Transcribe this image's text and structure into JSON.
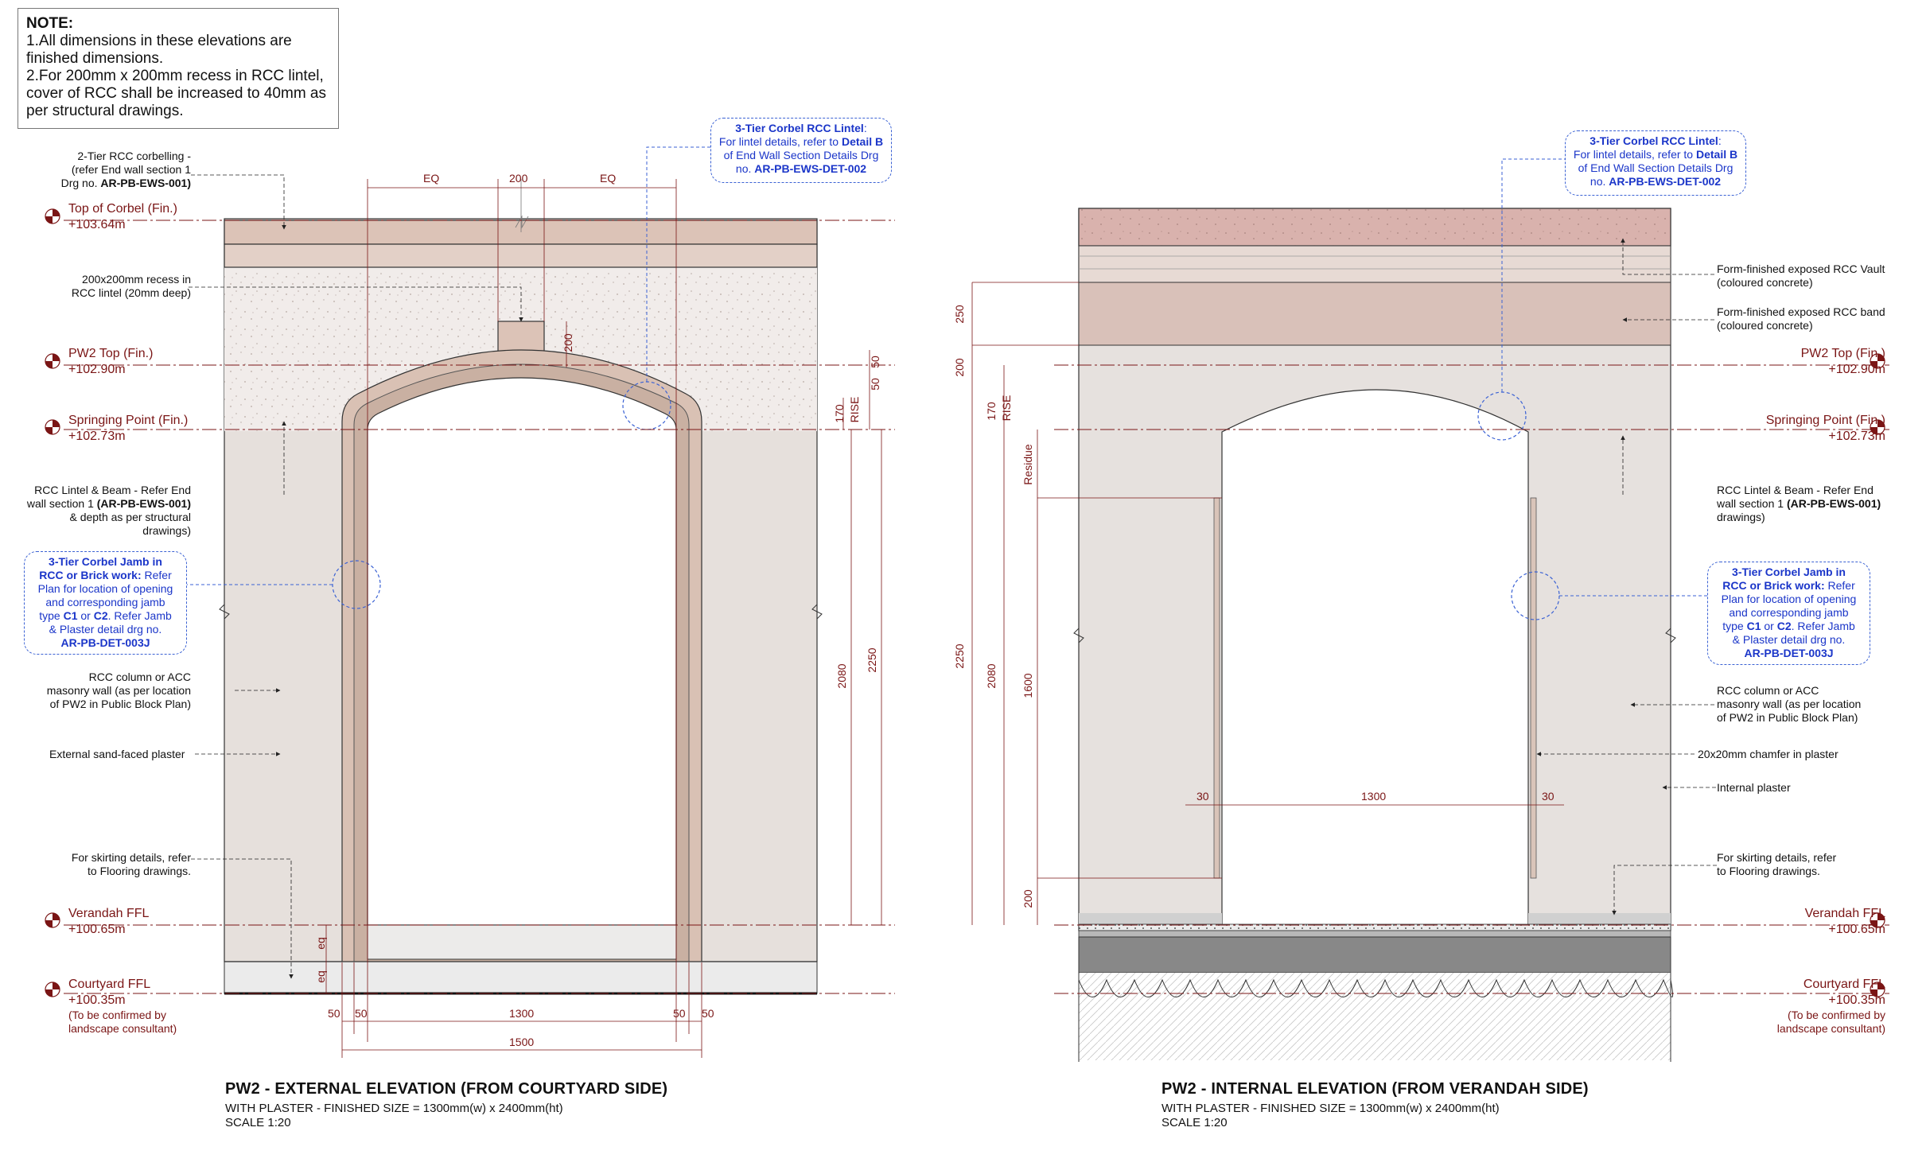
{
  "note": {
    "heading": "NOTE:",
    "line1": "1.All dimensions in these elevations are finished dimensions.",
    "line2": "2.For 200mm x 200mm recess in RCC lintel, cover of RCC shall be increased to 40mm as per structural drawings."
  },
  "left": {
    "labels": {
      "corbelling_a": "2-Tier RCC corbelling -",
      "corbelling_b": "(refer End wall section 1",
      "corbelling_c": "Drg no.",
      "corbelling_ref": "AR-PB-EWS-001)",
      "recess_a": "200x200mm recess in",
      "recess_b": "RCC lintel (20mm deep)",
      "lintel_a": "RCC Lintel & Beam - Refer End",
      "lintel_b": "wall section 1",
      "lintel_ref": "(AR-PB-EWS-001)",
      "lintel_c": "& depth as per structural",
      "lintel_d": "drawings)",
      "column_a": "RCC column or ACC",
      "column_b": "masonry wall (as per location",
      "column_c": "of PW2 in Public Block Plan)",
      "plaster": "External sand-faced plaster",
      "skirting_a": "For skirting details, refer",
      "skirting_b": "to Flooring drawings."
    },
    "jamb_callout": {
      "title_a": "3-Tier Corbel Jamb in",
      "title_b": "RCC or Brick work:",
      "text_a": "Refer",
      "text_b": "Plan for location of opening",
      "text_c": "and corresponding jamb",
      "text_d": "type",
      "c1": "C1",
      "or": "or",
      "c2": "C2",
      "text_e": ". Refer Jamb",
      "text_f": "& Plaster detail drg no.",
      "ref": "AR-PB-DET-003J"
    },
    "lintel_callout": {
      "title": "3-Tier Corbel RCC Lintel",
      "text_a": ":",
      "text_b": "For lintel details, refer to",
      "detail": "Detail B",
      "text_c": "of End Wall Section Details Drg",
      "text_d": "no.",
      "ref": "AR-PB-EWS-DET-002"
    },
    "levels": {
      "top_corbel": "Top of Corbel (Fin.)",
      "top_corbel_val": "+103.64m",
      "pw2_top": "PW2 Top (Fin.)",
      "pw2_top_val": "+102.90m",
      "springing": "Springing Point (Fin.)",
      "springing_val": "+102.73m",
      "verandah": "Verandah FFL",
      "verandah_val": "+100.65m",
      "courtyard": "Courtyard  FFL",
      "courtyard_val": "+100.35m",
      "courtyard_note_a": "(To be confirmed by",
      "courtyard_note_b": "landscape consultant)"
    },
    "dims": {
      "eq1": "EQ",
      "w200": "200",
      "eq2": "EQ",
      "d200": "200",
      "d50": "50",
      "d50b": "50",
      "d170": "170",
      "rise": "RISE",
      "d2080": "2080",
      "d2250": "2250",
      "eq_a": "eq",
      "eq_b": "eq",
      "b50a": "50",
      "b50b": "50",
      "b1300": "1300",
      "b50c": "50",
      "b50d": "50",
      "b1500": "1500"
    },
    "title": "PW2 - EXTERNAL ELEVATION (FROM COURTYARD SIDE)",
    "subtitle": "WITH PLASTER - FINISHED SIZE = 1300mm(w) x 2400mm(ht)",
    "scale": "SCALE 1:20"
  },
  "right": {
    "labels": {
      "vault_a": "Form-finished exposed RCC Vault",
      "vault_b": "(coloured concrete)",
      "band_a": "Form-finished exposed RCC band",
      "band_b": "(coloured concrete)",
      "lintel_a": "RCC Lintel & Beam - Refer End",
      "lintel_b": "wall section 1",
      "lintel_ref": "(AR-PB-EWS-001)",
      "lintel_c": "drawings)",
      "column_a": "RCC column or ACC",
      "column_b": "masonry wall (as per location",
      "column_c": "of PW2 in Public Block Plan)",
      "chamfer": "20x20mm chamfer in plaster",
      "plaster": "Internal plaster",
      "skirting_a": "For skirting details, refer",
      "skirting_b": "to Flooring drawings."
    },
    "jamb_callout": {
      "title_a": "3-Tier Corbel Jamb in",
      "title_b": "RCC or Brick work:",
      "text_a": "Refer",
      "text_b": "Plan for location of opening",
      "text_c": "and corresponding jamb",
      "text_d": "type",
      "c1": "C1",
      "or": "or",
      "c2": "C2",
      "text_e": ". Refer Jamb",
      "text_f": "& Plaster detail drg no.",
      "ref": "AR-PB-DET-003J"
    },
    "lintel_callout": {
      "title": "3-Tier Corbel RCC Lintel",
      "text_a": ":",
      "text_b": "For lintel details, refer to",
      "detail": "Detail B",
      "text_c": "of End Wall Section Details Drg",
      "text_d": "no.",
      "ref": "AR-PB-EWS-DET-002"
    },
    "levels": {
      "pw2_top": "PW2 Top (Fin.)",
      "pw2_top_val": "+102.90m",
      "springing": "Springing Point (Fin.)",
      "springing_val": "+102.73m",
      "verandah": "Verandah FFL",
      "verandah_val": "+100.65m",
      "courtyard": "Courtyard  FFL",
      "courtyard_val": "+100.35m",
      "courtyard_note_a": "(To be confirmed by",
      "courtyard_note_b": "landscape consultant)"
    },
    "dims": {
      "d250": "250",
      "d200": "200",
      "d170": "170",
      "rise": "RISE",
      "residue": "Residue",
      "d2250": "2250",
      "d2080": "2080",
      "d1600": "1600",
      "d200b": "200",
      "d30a": "30",
      "d1300": "1300",
      "d30b": "30"
    },
    "title": "PW2 - INTERNAL ELEVATION (FROM VERANDAH SIDE)",
    "subtitle": "WITH PLASTER - FINISHED SIZE = 1300mm(w) x 2400mm(ht)",
    "scale": "SCALE 1:20"
  }
}
